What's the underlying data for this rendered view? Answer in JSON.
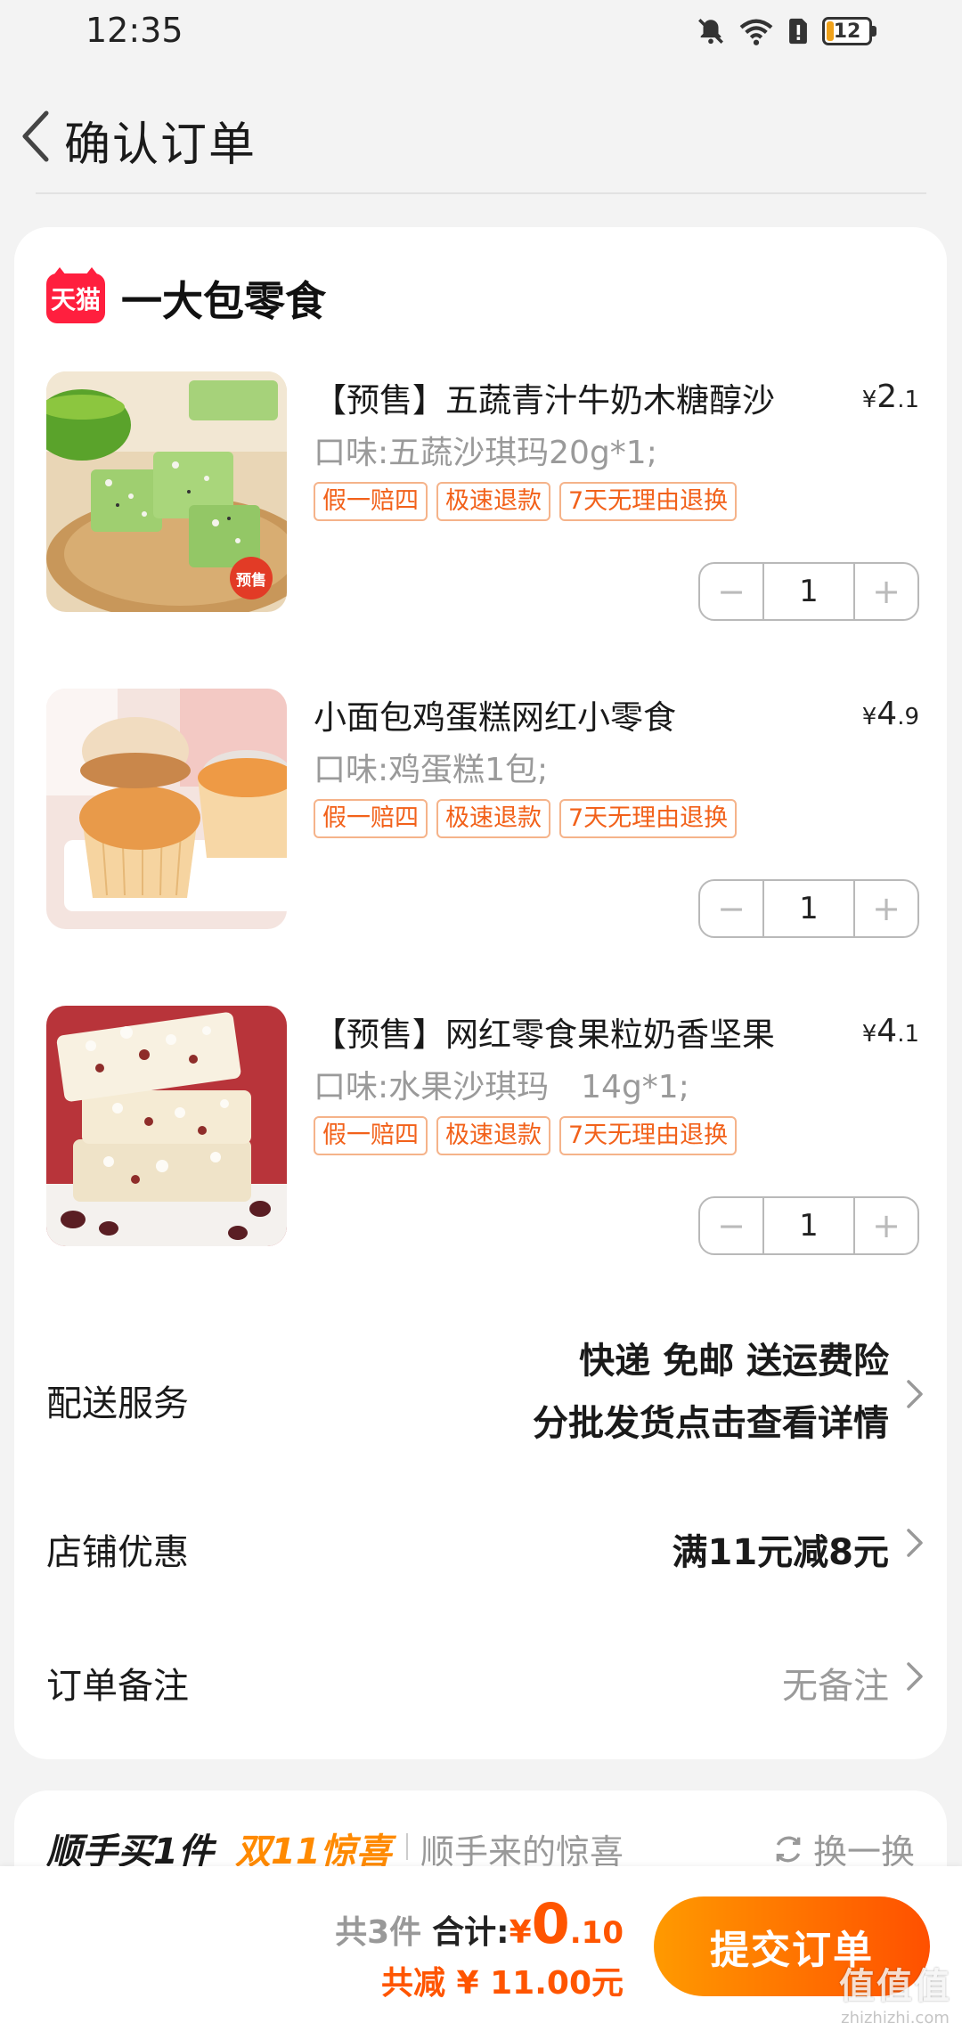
{
  "status_bar": {
    "time": "12:35",
    "battery": "12"
  },
  "header": {
    "title": "确认订单"
  },
  "shop": {
    "badge": "天猫",
    "name": "一大包零食"
  },
  "products": [
    {
      "title": "【预售】五蔬青汁牛奶木糖醇沙",
      "price_symbol": "¥",
      "price_int": "2",
      "price_dec": ".1",
      "spec": "口味:五蔬沙琪玛20g*1;",
      "tags": [
        "假一赔四",
        "极速退款",
        "7天无理由退换"
      ],
      "quantity": "1",
      "image_badge": "预售"
    },
    {
      "title": "小面包鸡蛋糕网红小零食",
      "price_symbol": "¥",
      "price_int": "4",
      "price_dec": ".9",
      "spec": "口味:鸡蛋糕1包;",
      "tags": [
        "假一赔四",
        "极速退款",
        "7天无理由退换"
      ],
      "quantity": "1"
    },
    {
      "title": "【预售】网红零食果粒奶香坚果",
      "price_symbol": "¥",
      "price_int": "4",
      "price_dec": ".1",
      "spec": "口味:水果沙琪玛　14g*1;",
      "tags": [
        "假一赔四",
        "极速退款",
        "7天无理由退换"
      ],
      "quantity": "1"
    }
  ],
  "stepper": {
    "minus": "−",
    "plus": "+"
  },
  "delivery": {
    "label": "配送服务",
    "line1": "快递 免邮 送运费险",
    "line2": "分批发货点击查看详情"
  },
  "discount": {
    "label": "店铺优惠",
    "value": "满11元减8元"
  },
  "note": {
    "label": "订单备注",
    "value": "无备注"
  },
  "addon": {
    "title": "顺手买1件",
    "highlight": "双11惊喜",
    "subtitle": "顺手来的惊喜",
    "refresh": "换一换"
  },
  "bottom": {
    "count": "共3件",
    "total_label": "合计:",
    "total_symbol": "¥",
    "total_int": "0",
    "total_dec": ".10",
    "saving": "共减 ¥ 11.00元",
    "submit": "提交订单"
  },
  "watermark": {
    "main": "值值值",
    "sub": "zhizhizhi.com"
  },
  "colors": {
    "accent": "#ff5500",
    "tag_text": "#f2611a",
    "tag_border": "#f5b38a",
    "tmall": "#ff1f3e"
  }
}
